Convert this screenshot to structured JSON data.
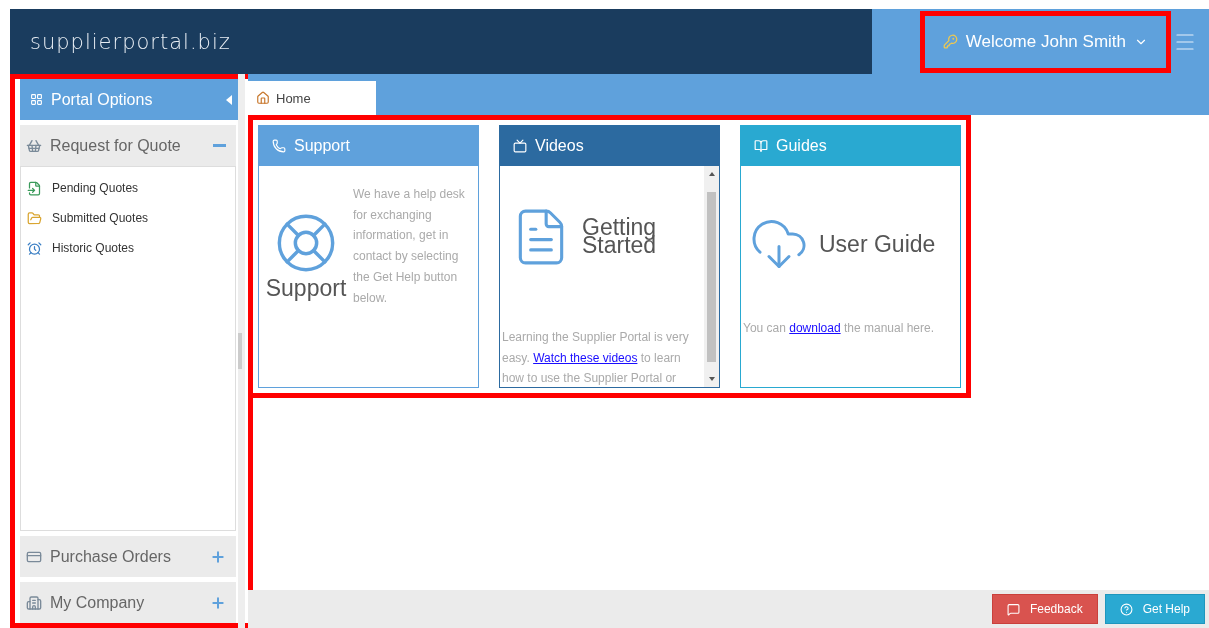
{
  "header": {
    "logo": "supplierportal.biz",
    "user_menu": {
      "label": "Welcome John Smith",
      "highlighted": true
    }
  },
  "sidebar": {
    "highlighted": true,
    "title": "Portal Options",
    "sections": [
      {
        "label": "Request for Quote",
        "expanded": true,
        "items": [
          {
            "label": "Pending Quotes"
          },
          {
            "label": "Submitted Quotes"
          },
          {
            "label": "Historic Quotes"
          }
        ]
      },
      {
        "label": "Purchase Orders",
        "expanded": false
      },
      {
        "label": "My Company",
        "expanded": false
      }
    ]
  },
  "tabs": [
    {
      "label": "Home",
      "selected": true
    }
  ],
  "cards_highlighted": true,
  "cards": [
    {
      "kind": "support",
      "title": "Support",
      "color": "#5fa1dc",
      "feature": "Support",
      "text": "We have a help desk for exchanging information, get in contact by selecting the Get Help button below."
    },
    {
      "kind": "videos",
      "title": "Videos",
      "color": "#2c6aa0",
      "feature": "Getting Started",
      "text_before": "Learning the Supplier Portal is very easy. ",
      "link": "Watch these videos",
      "text_after": " to learn how to use the Supplier Portal or"
    },
    {
      "kind": "guides",
      "title": "Guides",
      "color": "#29a9d1",
      "feature": "User Guide",
      "text_before": "You can ",
      "link": "download",
      "text_after": " the manual here."
    }
  ],
  "footer": {
    "buttons": [
      {
        "kind": "feedback",
        "label": "Feedback"
      },
      {
        "kind": "help",
        "label": "Get Help"
      }
    ]
  }
}
